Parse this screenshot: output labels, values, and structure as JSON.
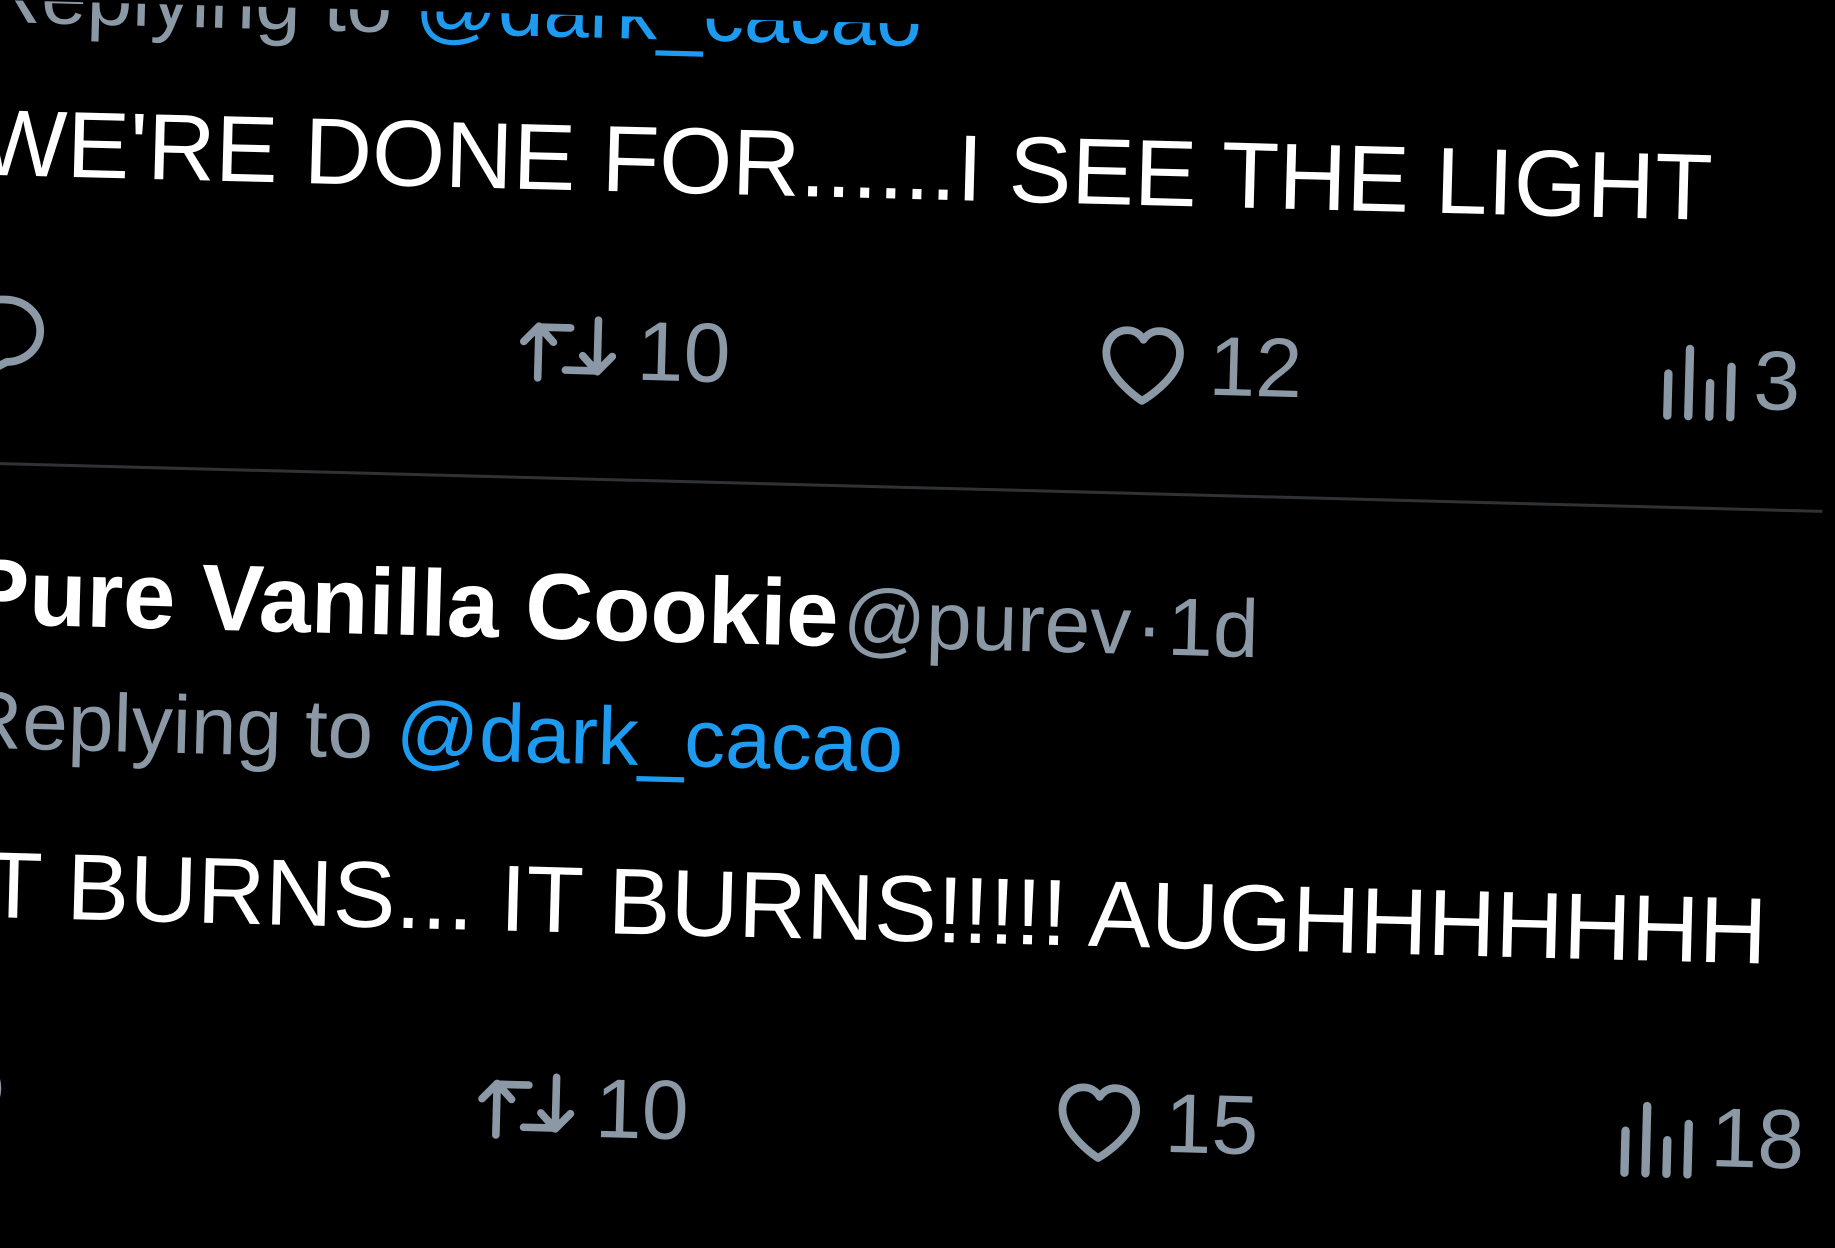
{
  "colors": {
    "background": "#000000",
    "text": "#ffffff",
    "muted": "#8b98a5",
    "accent": "#1d9bf0",
    "divider": "#2f3336"
  },
  "tweets": [
    {
      "reply_prefix": "Replying to",
      "reply_to": "@dark_cacao",
      "text": "WE'RE DONE FOR......I SEE THE LIGHT",
      "actions": {
        "reply_icon": "reply-icon",
        "retweet_icon": "retweet-icon",
        "retweet_count": "10",
        "like_icon": "heart-icon",
        "like_count": "12",
        "views_icon": "views-icon",
        "views_count": "3"
      }
    },
    {
      "author_name": "Pure Vanilla Cookie",
      "author_handle": "@purev",
      "separator": "·",
      "time": "1d",
      "reply_prefix": "Replying to",
      "reply_to": "@dark_cacao",
      "text": "IT BURNS... IT BURNS!!!!! AUGHHHHHHH",
      "actions": {
        "reply_icon": "reply-icon",
        "retweet_icon": "retweet-icon",
        "retweet_count": "10",
        "like_icon": "heart-icon",
        "like_count": "15",
        "views_icon": "views-icon",
        "views_count": "18"
      }
    }
  ]
}
